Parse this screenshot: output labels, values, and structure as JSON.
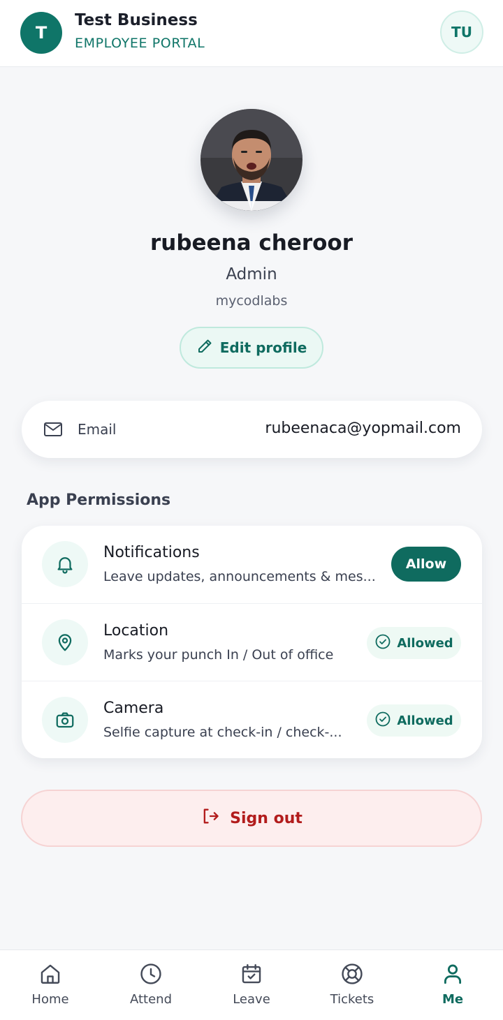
{
  "header": {
    "business_initial": "T",
    "business_name": "Test Business",
    "portal_label": "EMPLOYEE PORTAL",
    "user_initials": "TU"
  },
  "profile": {
    "name": "rubeena cheroor",
    "role": "Admin",
    "organization": "mycodlabs",
    "edit_label": "Edit profile"
  },
  "contact": {
    "email_label": "Email",
    "email_value": "rubeenaca@yopmail.com"
  },
  "permissions": {
    "title": "App Permissions",
    "items": [
      {
        "icon": "bell-icon",
        "name": "Notifications",
        "description": "Leave updates, announcements & mes...",
        "action": "Allow"
      },
      {
        "icon": "location-pin-icon",
        "name": "Location",
        "description": "Marks your punch In / Out of office",
        "status": "Allowed"
      },
      {
        "icon": "camera-icon",
        "name": "Camera",
        "description": "Selfie capture at check-in / check-...",
        "status": "Allowed"
      }
    ]
  },
  "signout": {
    "label": "Sign out"
  },
  "nav": {
    "items": [
      {
        "label": "Home",
        "icon": "home-icon"
      },
      {
        "label": "Attend",
        "icon": "clock-icon"
      },
      {
        "label": "Leave",
        "icon": "calendar-icon"
      },
      {
        "label": "Tickets",
        "icon": "lifebuoy-icon"
      },
      {
        "label": "Me",
        "icon": "user-icon",
        "active": true
      }
    ]
  },
  "colors": {
    "accent": "#0f6b5f",
    "danger": "#b21c1c",
    "background": "#f6f7f9"
  }
}
